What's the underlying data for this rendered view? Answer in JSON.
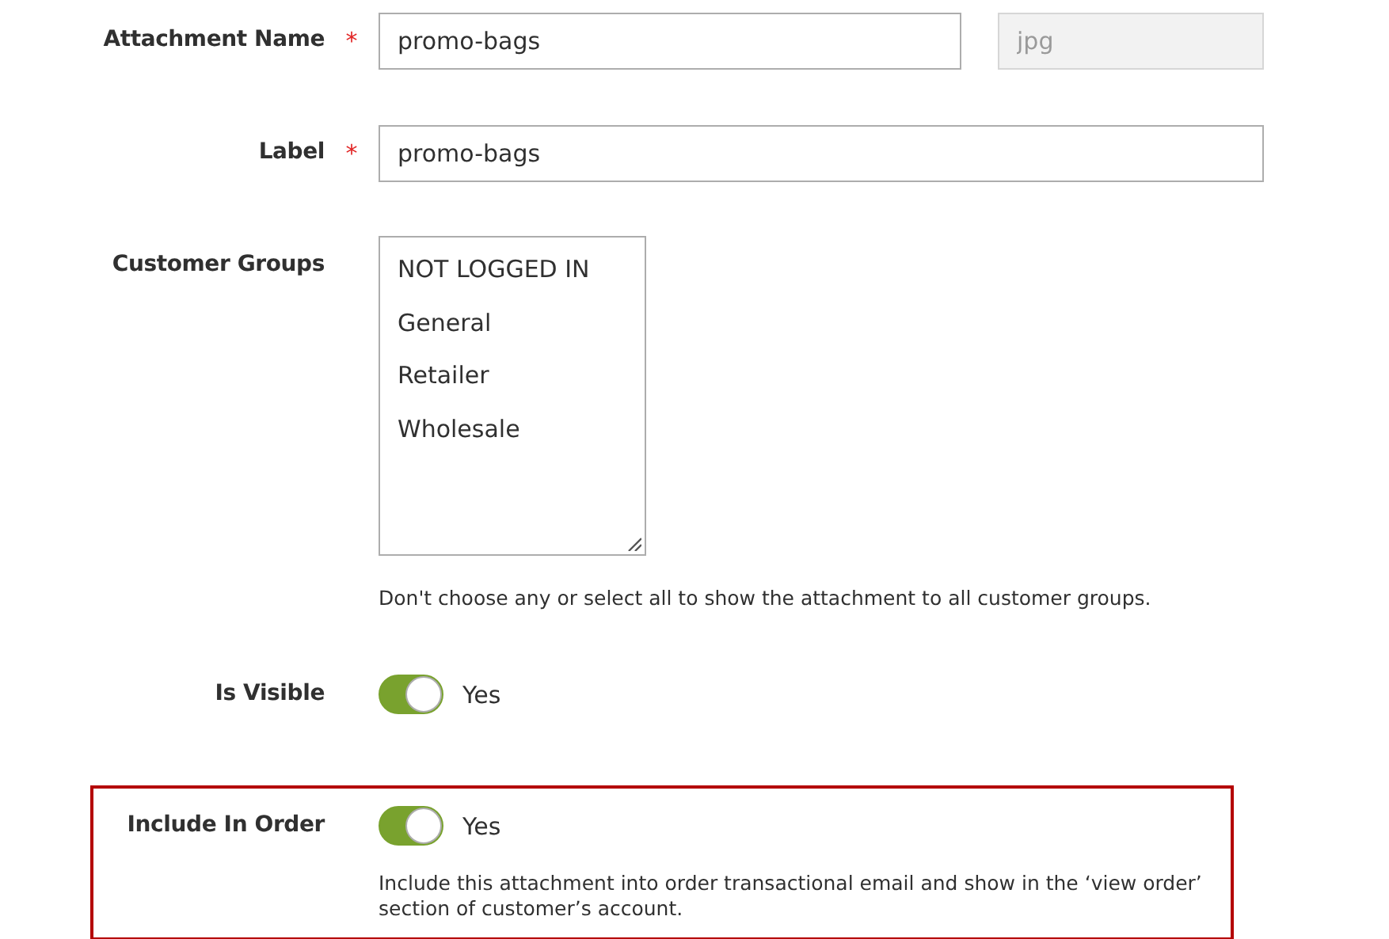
{
  "fields": [
    {
      "kind": "text",
      "label": "Attachment Name",
      "required_mark": "*",
      "value": "promo-bags",
      "highlighted": false,
      "extension": {
        "value": "jpg",
        "disabled": true
      }
    },
    {
      "kind": "text",
      "label": "Label",
      "required_mark": "*",
      "value": "promo-bags",
      "highlighted": false
    },
    {
      "kind": "multiselect",
      "label": "Customer Groups",
      "highlighted": false,
      "options": [
        {
          "label": "NOT LOGGED IN",
          "selected": false
        },
        {
          "label": "General",
          "selected": false
        },
        {
          "label": "Retailer",
          "selected": false
        },
        {
          "label": "Wholesale",
          "selected": false
        }
      ],
      "note": "Don't choose any or select all to show the attachment to all customer groups."
    },
    {
      "kind": "toggle",
      "label": "Is Visible",
      "on": true,
      "value_label": "Yes",
      "highlighted": false
    },
    {
      "kind": "toggle",
      "label": "Include In Order",
      "on": true,
      "value_label": "Yes",
      "highlighted": true,
      "note": "Include this attachment into order transactional email and show in the ‘view order’ section of customer’s account."
    }
  ]
}
